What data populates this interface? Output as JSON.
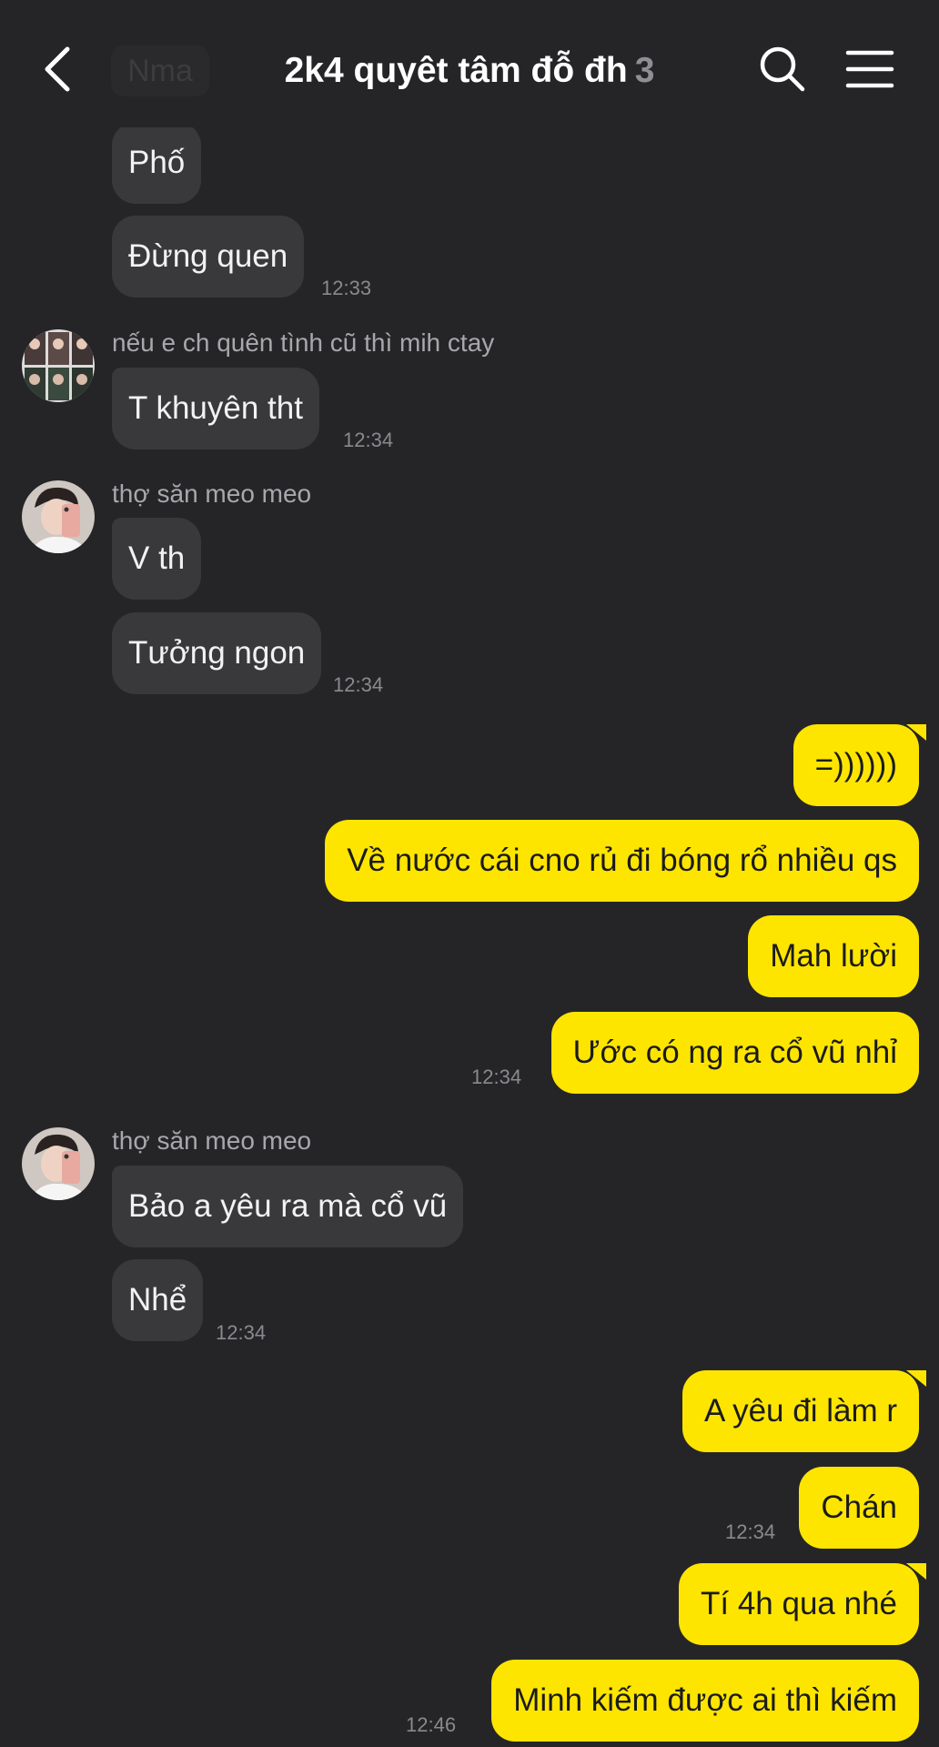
{
  "header": {
    "back_icon": "chevron-left-icon",
    "ghost_chip_text": "Nma",
    "title": "2k4 quyêt tâm đỗ đh",
    "member_count": "3",
    "search_icon": "search-icon",
    "menu_icon": "hamburger-menu-icon"
  },
  "colors": {
    "background": "#252527",
    "incoming_bubble": "#39393c",
    "outgoing_bubble": "#fee500",
    "timestamp": "#8a8a8e"
  },
  "messages": [
    {
      "dir": "in",
      "text": "Phố"
    },
    {
      "dir": "in",
      "text": "Đừng quen",
      "time": "12:33"
    },
    {
      "dir": "in",
      "sender": "nếu e ch quên tình cũ thì mih ctay",
      "text": "T khuyên tht",
      "time": "12:34"
    },
    {
      "dir": "in",
      "sender": "thợ săn meo meo",
      "text": "V th"
    },
    {
      "dir": "in",
      "text": "Tưởng ngon",
      "time": "12:34"
    },
    {
      "dir": "out",
      "text": "=))))))"
    },
    {
      "dir": "out",
      "text": "Về nước cái cno rủ đi bóng rổ nhiều qs"
    },
    {
      "dir": "out",
      "text": "Mah lười"
    },
    {
      "dir": "out",
      "text": "Ước có ng ra cổ vũ nhỉ",
      "time": "12:34"
    },
    {
      "dir": "in",
      "sender": "thợ săn meo meo",
      "text": "Bảo a yêu ra mà cổ vũ"
    },
    {
      "dir": "in",
      "text": "Nhể",
      "time": "12:34"
    },
    {
      "dir": "out",
      "text": "A yêu đi làm r"
    },
    {
      "dir": "out",
      "text": "Chán",
      "time": "12:34"
    },
    {
      "dir": "out",
      "text": "Tí 4h qua nhé"
    },
    {
      "dir": "out",
      "text": "Minh kiếm được ai thì kiếm",
      "time": "12:46"
    }
  ]
}
